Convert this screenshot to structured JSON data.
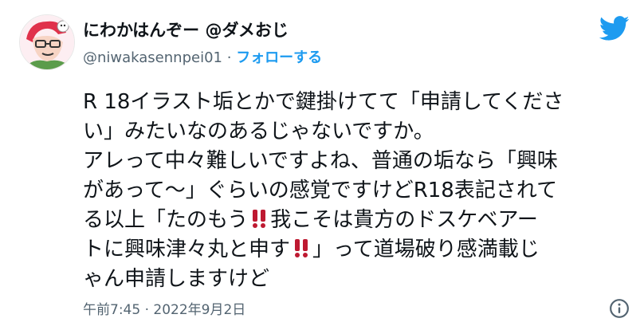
{
  "user": {
    "display_name": "にわかはんぞー @ダメおじ",
    "handle": "@niwakasennpei01",
    "separator": "·",
    "follow_label": "フォローする"
  },
  "tweet": {
    "lines": [
      [
        "R 18イラスト垢とかで鍵掛けてて「申請してくださ"
      ],
      [
        "い」みたいなのあるじゃないですか。"
      ],
      [
        "アレって中々難しいですよね、普通の垢なら「興味"
      ],
      [
        "があって〜」ぐらいの感覚ですけどR18表記されて"
      ],
      [
        "る以上「たのもう",
        "我こそは貴方のドスケベアー"
      ],
      [
        "トに興味津々丸と申す",
        "」って道場破り感満載じ"
      ],
      [
        "ゃん申請しますけど"
      ]
    ],
    "emoji_name": "double-exclamation-emoji",
    "timestamp": "午前7:45 · 2022年9月2日"
  },
  "icons": {
    "brand": "twitter-bird-icon",
    "info": "info-icon",
    "accent_color": "#1d9bf0",
    "emoji_color": "#be1931"
  }
}
